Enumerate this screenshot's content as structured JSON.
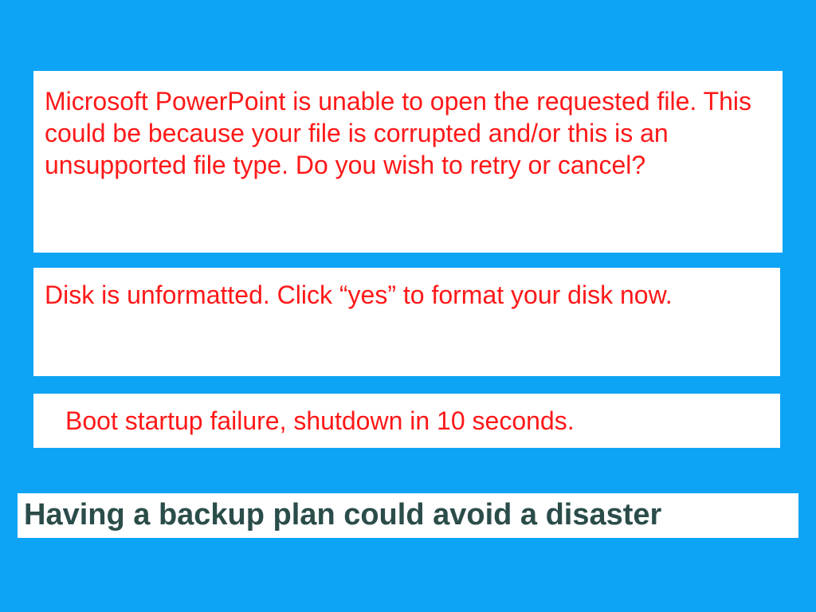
{
  "messages": {
    "powerpoint_error": "Microsoft PowerPoint is unable to open the requested file. This could be because your file is corrupted and/or this is an unsupported file type. Do you wish to retry or cancel?",
    "disk_unformatted": "Disk is unformatted. Click “yes” to format your disk now.",
    "boot_failure": "Boot startup failure, shutdown in 10 seconds.",
    "backup_headline": "Having a backup plan could avoid a disaster"
  }
}
